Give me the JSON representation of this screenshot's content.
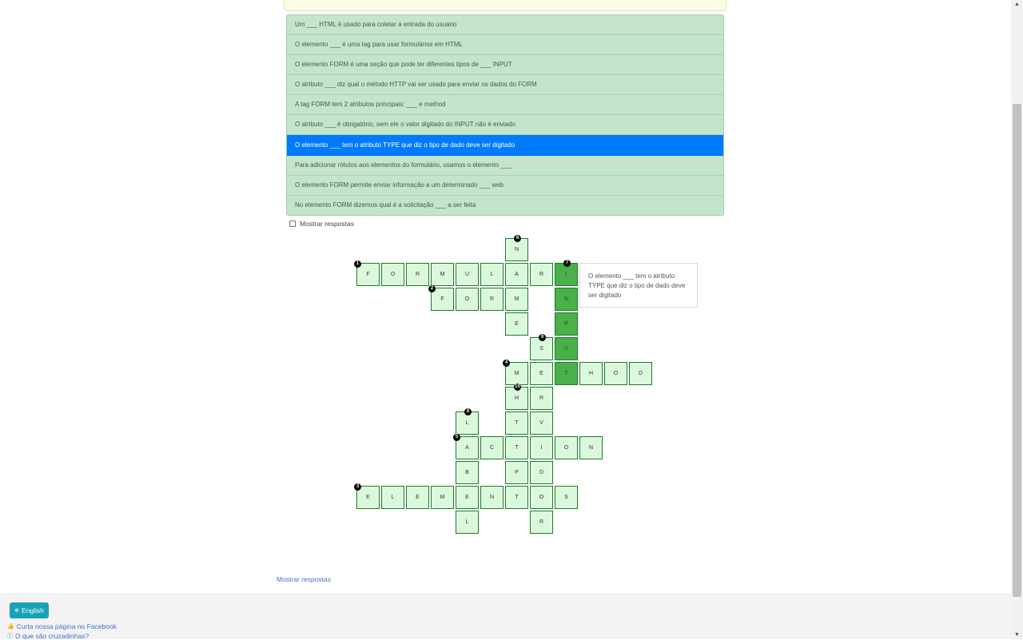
{
  "clues": [
    "Um ___ HTML é usado para coletar a entrada do usuário",
    "O elemento ___ é uma tag para usar formulários em HTML",
    "O elemento FORM é uma seção que pode ter diferentes tipos de ___ INPUT",
    "O atributo ___ diz qual o método HTTP vai ser usado para enviar os dados do FORM",
    "A tag FORM tem 2 atributos principais: ___ e method",
    "O atributo ___ é obrigatório, sem ele o valor digitado do INPUT não é enviado",
    "O elemento ___ tem o atributo TYPE que diz o tipo de dado deve ser digitado",
    "Para adicionar rótulos aos elementos do formulário, usamos o elemento ___",
    "O elemento FORM permite enviar informação a um determinado ___ web",
    "No elemento FORM dizemos qual é a solicitação ___ a ser feita"
  ],
  "active_clue_index": 6,
  "show_answers_checkbox_label": "Mostrar respostas",
  "tooltip_text": "O elemento ___ tem o atributo TYPE que diz o tipo de dado deve ser digitado",
  "grid": {
    "cells": [
      {
        "col": 6,
        "row": 0,
        "letter": "N",
        "num": "6",
        "numpos": "top"
      },
      {
        "col": 0,
        "row": 1,
        "letter": "F",
        "num": "1"
      },
      {
        "col": 1,
        "row": 1,
        "letter": "O"
      },
      {
        "col": 2,
        "row": 1,
        "letter": "R"
      },
      {
        "col": 3,
        "row": 1,
        "letter": "M"
      },
      {
        "col": 4,
        "row": 1,
        "letter": "U"
      },
      {
        "col": 5,
        "row": 1,
        "letter": "L"
      },
      {
        "col": 6,
        "row": 1,
        "letter": "A"
      },
      {
        "col": 7,
        "row": 1,
        "letter": "R"
      },
      {
        "col": 8,
        "row": 1,
        "letter": "I",
        "num": "7",
        "numpos": "top",
        "hl": true
      },
      {
        "col": 3,
        "row": 2,
        "letter": "F",
        "num": "2"
      },
      {
        "col": 4,
        "row": 2,
        "letter": "O"
      },
      {
        "col": 5,
        "row": 2,
        "letter": "R"
      },
      {
        "col": 6,
        "row": 2,
        "letter": "M"
      },
      {
        "col": 8,
        "row": 2,
        "letter": "N",
        "hl": true
      },
      {
        "col": 6,
        "row": 3,
        "letter": "E"
      },
      {
        "col": 8,
        "row": 3,
        "letter": "P",
        "hl": true
      },
      {
        "col": 7,
        "row": 4,
        "letter": "S",
        "num": "9",
        "numpos": "top"
      },
      {
        "col": 8,
        "row": 4,
        "letter": "U",
        "hl": true
      },
      {
        "col": 6,
        "row": 5,
        "letter": "M",
        "num": "4"
      },
      {
        "col": 7,
        "row": 5,
        "letter": "E"
      },
      {
        "col": 8,
        "row": 5,
        "letter": "T",
        "hl": true
      },
      {
        "col": 9,
        "row": 5,
        "letter": "H"
      },
      {
        "col": 10,
        "row": 5,
        "letter": "O"
      },
      {
        "col": 11,
        "row": 5,
        "letter": "D"
      },
      {
        "col": 6,
        "row": 6,
        "letter": "H",
        "num": "10",
        "numpos": "top"
      },
      {
        "col": 7,
        "row": 6,
        "letter": "R"
      },
      {
        "col": 4,
        "row": 7,
        "letter": "L",
        "num": "8",
        "numpos": "top"
      },
      {
        "col": 6,
        "row": 7,
        "letter": "T"
      },
      {
        "col": 7,
        "row": 7,
        "letter": "V"
      },
      {
        "col": 4,
        "row": 8,
        "letter": "A",
        "num": "5"
      },
      {
        "col": 5,
        "row": 8,
        "letter": "C"
      },
      {
        "col": 6,
        "row": 8,
        "letter": "T"
      },
      {
        "col": 7,
        "row": 8,
        "letter": "I"
      },
      {
        "col": 8,
        "row": 8,
        "letter": "O"
      },
      {
        "col": 9,
        "row": 8,
        "letter": "N"
      },
      {
        "col": 4,
        "row": 9,
        "letter": "B"
      },
      {
        "col": 6,
        "row": 9,
        "letter": "P"
      },
      {
        "col": 7,
        "row": 9,
        "letter": "D"
      },
      {
        "col": 0,
        "row": 10,
        "letter": "E",
        "num": "3"
      },
      {
        "col": 1,
        "row": 10,
        "letter": "L"
      },
      {
        "col": 2,
        "row": 10,
        "letter": "E"
      },
      {
        "col": 3,
        "row": 10,
        "letter": "M"
      },
      {
        "col": 4,
        "row": 10,
        "letter": "E"
      },
      {
        "col": 5,
        "row": 10,
        "letter": "N"
      },
      {
        "col": 6,
        "row": 10,
        "letter": "T"
      },
      {
        "col": 7,
        "row": 10,
        "letter": "O"
      },
      {
        "col": 8,
        "row": 10,
        "letter": "S"
      },
      {
        "col": 4,
        "row": 11,
        "letter": "L"
      },
      {
        "col": 7,
        "row": 11,
        "letter": "R"
      }
    ]
  },
  "mostrar_link": "Mostrar respostas",
  "footer": {
    "language_button": "English",
    "facebook_link": "Curta nossa página no Facebook",
    "about_link": "O que são cruzadinhas?"
  },
  "colors": {
    "clue_bg": "#c3e6cb",
    "clue_active": "#007bff",
    "cell_bg": "#dcf8dc",
    "cell_highlight": "#4ab04a",
    "language_button": "#17a2b8"
  }
}
